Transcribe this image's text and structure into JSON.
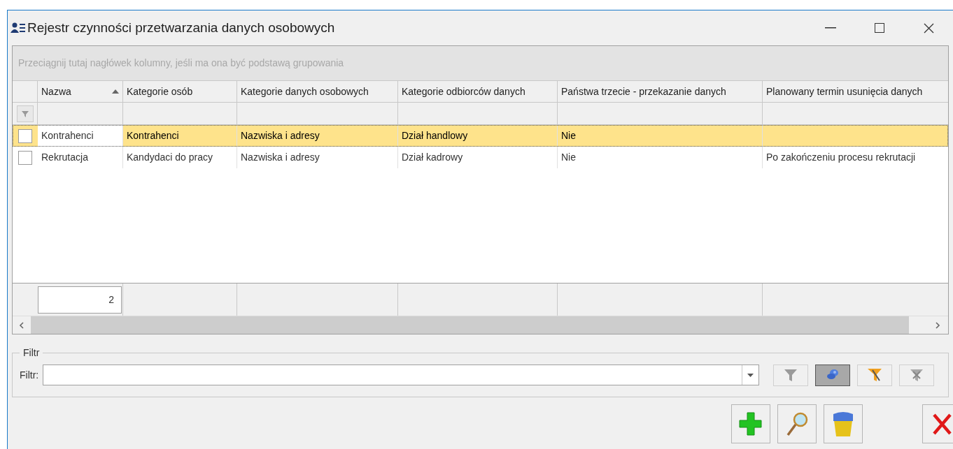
{
  "window": {
    "title": "Rejestr czynności przetwarzania danych osobowych"
  },
  "grid": {
    "group_hint": "Przeciągnij tutaj nagłówek kolumny, jeśli ma ona być podstawą grupowania",
    "columns": [
      {
        "label": "Nazwa",
        "sorted": true
      },
      {
        "label": "Kategorie osób",
        "sorted": false
      },
      {
        "label": "Kategorie danych osobowych",
        "sorted": false
      },
      {
        "label": "Kategorie odbiorców danych",
        "sorted": false
      },
      {
        "label": "Państwa trzecie - przekazanie danych",
        "sorted": false
      },
      {
        "label": "Planowany termin usunięcia danych",
        "sorted": false
      }
    ],
    "rows": [
      {
        "checked": false,
        "selected": true,
        "cells": [
          "Kontrahenci",
          "Kontrahenci",
          "Nazwiska i adresy",
          "Dział handlowy",
          "Nie",
          ""
        ]
      },
      {
        "checked": false,
        "selected": false,
        "cells": [
          "Rekrutacja",
          "Kandydaci do pracy",
          "Nazwiska i adresy",
          "Dział kadrowy",
          "Nie",
          "Po zakończeniu procesu rekrutacji"
        ]
      }
    ],
    "footer_count": "2"
  },
  "filter": {
    "group_label": "Filtr",
    "label": "Filtr:",
    "tools": [
      {
        "kind": "funnel",
        "pressed": false
      },
      {
        "kind": "pin",
        "pressed": true
      },
      {
        "kind": "funnel-edit",
        "pressed": false
      },
      {
        "kind": "funnel-clear",
        "pressed": false
      }
    ]
  },
  "actions": [
    {
      "kind": "add"
    },
    {
      "kind": "search"
    },
    {
      "kind": "delete"
    },
    {
      "kind": "close"
    }
  ]
}
